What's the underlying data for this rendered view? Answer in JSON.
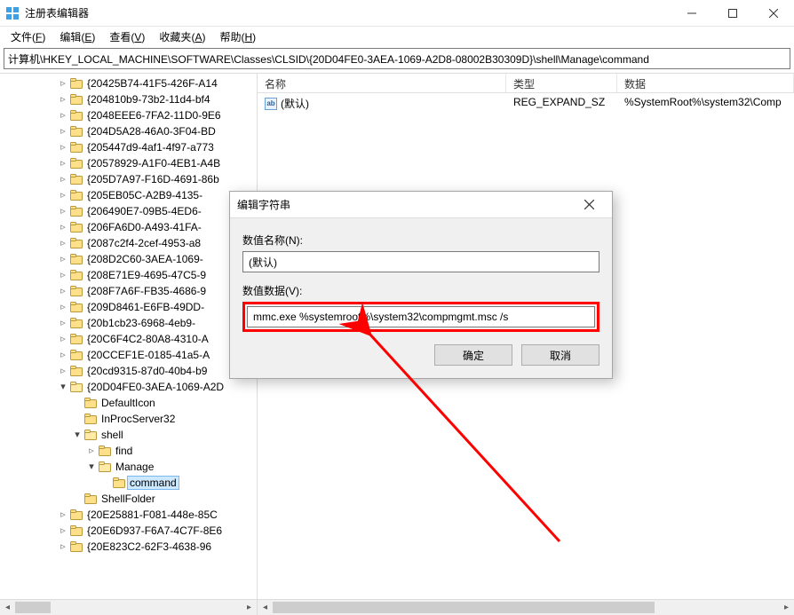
{
  "window": {
    "title": "注册表编辑器"
  },
  "menu": {
    "file": {
      "text": "文件",
      "accel": "F"
    },
    "edit": {
      "text": "编辑",
      "accel": "E"
    },
    "view": {
      "text": "查看",
      "accel": "V"
    },
    "fav": {
      "text": "收藏夹",
      "accel": "A"
    },
    "help": {
      "text": "帮助",
      "accel": "H"
    }
  },
  "address": "计算机\\HKEY_LOCAL_MACHINE\\SOFTWARE\\Classes\\CLSID\\{20D04FE0-3AEA-1069-A2D8-08002B30309D}\\shell\\Manage\\command",
  "tree": {
    "items": [
      {
        "depth": 4,
        "toggle": ">",
        "label": "{20425B74-41F5-426F-A14"
      },
      {
        "depth": 4,
        "toggle": ">",
        "label": "{204810b9-73b2-11d4-bf4"
      },
      {
        "depth": 4,
        "toggle": ">",
        "label": "{2048EEE6-7FA2-11D0-9E6"
      },
      {
        "depth": 4,
        "toggle": ">",
        "label": "{204D5A28-46A0-3F04-BD"
      },
      {
        "depth": 4,
        "toggle": ">",
        "label": "{205447d9-4af1-4f97-a773"
      },
      {
        "depth": 4,
        "toggle": ">",
        "label": "{20578929-A1F0-4EB1-A4B"
      },
      {
        "depth": 4,
        "toggle": ">",
        "label": "{205D7A97-F16D-4691-86b"
      },
      {
        "depth": 4,
        "toggle": ">",
        "label": "{205EB05C-A2B9-4135-"
      },
      {
        "depth": 4,
        "toggle": ">",
        "label": "{206490E7-09B5-4ED6-"
      },
      {
        "depth": 4,
        "toggle": ">",
        "label": "{206FA6D0-A493-41FA-"
      },
      {
        "depth": 4,
        "toggle": ">",
        "label": "{2087c2f4-2cef-4953-a8"
      },
      {
        "depth": 4,
        "toggle": ">",
        "label": "{208D2C60-3AEA-1069-"
      },
      {
        "depth": 4,
        "toggle": ">",
        "label": "{208E71E9-4695-47C5-9"
      },
      {
        "depth": 4,
        "toggle": ">",
        "label": "{208F7A6F-FB35-4686-9"
      },
      {
        "depth": 4,
        "toggle": ">",
        "label": "{209D8461-E6FB-49DD-"
      },
      {
        "depth": 4,
        "toggle": ">",
        "label": "{20b1cb23-6968-4eb9-"
      },
      {
        "depth": 4,
        "toggle": ">",
        "label": "{20C6F4C2-80A8-4310-A"
      },
      {
        "depth": 4,
        "toggle": ">",
        "label": "{20CCEF1E-0185-41a5-A"
      },
      {
        "depth": 4,
        "toggle": ">",
        "label": "{20cd9315-87d0-40b4-b9"
      },
      {
        "depth": 4,
        "toggle": "v",
        "label": "{20D04FE0-3AEA-1069-A2D",
        "open": true
      },
      {
        "depth": 5,
        "toggle": " ",
        "label": "DefaultIcon"
      },
      {
        "depth": 5,
        "toggle": " ",
        "label": "InProcServer32"
      },
      {
        "depth": 5,
        "toggle": "v",
        "label": "shell",
        "open": true
      },
      {
        "depth": 6,
        "toggle": ">",
        "label": "find"
      },
      {
        "depth": 6,
        "toggle": "v",
        "label": "Manage",
        "open": true
      },
      {
        "depth": 7,
        "toggle": " ",
        "label": "command",
        "selected": true
      },
      {
        "depth": 5,
        "toggle": " ",
        "label": "ShellFolder"
      },
      {
        "depth": 4,
        "toggle": ">",
        "label": "{20E25881-F081-448e-85C"
      },
      {
        "depth": 4,
        "toggle": ">",
        "label": "{20E6D937-F6A7-4C7F-8E6"
      },
      {
        "depth": 4,
        "toggle": ">",
        "label": "{20E823C2-62F3-4638-96"
      }
    ]
  },
  "list": {
    "headers": {
      "name": "名称",
      "type": "类型",
      "data": "数据"
    },
    "rows": [
      {
        "name": "(默认)",
        "type": "REG_EXPAND_SZ",
        "data": "%SystemRoot%\\system32\\Comp"
      }
    ]
  },
  "dialog": {
    "title": "编辑字符串",
    "name_label": "数值名称(N):",
    "name_value": "(默认)",
    "data_label": "数值数据(V):",
    "data_value": "mmc.exe %systemroot%\\system32\\compmgmt.msc /s",
    "ok": "确定",
    "cancel": "取消"
  }
}
